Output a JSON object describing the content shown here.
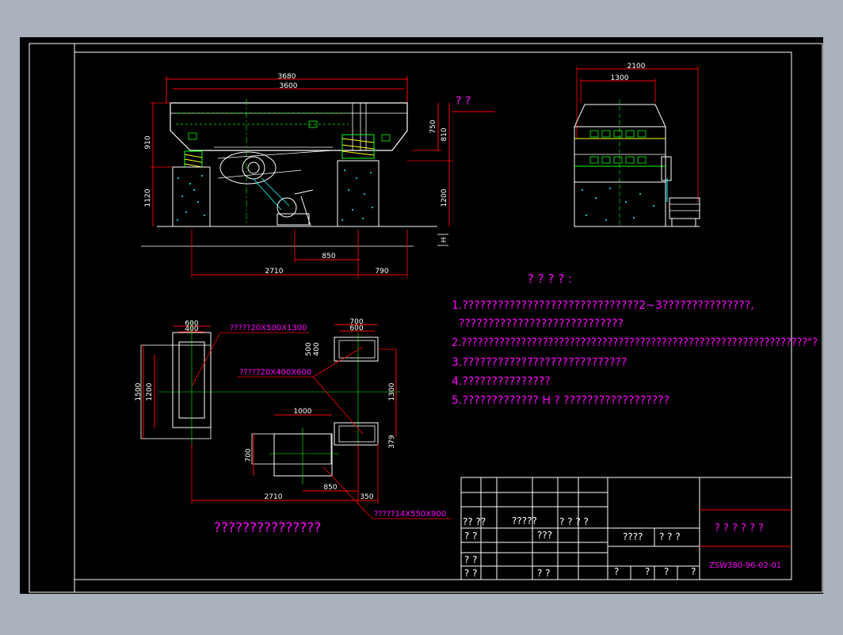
{
  "front_view": {
    "dims": {
      "total_length": "3680",
      "inner_length": "3600",
      "height_top": "910",
      "height_bottom": "1120",
      "right_a": "750",
      "right_b": "810",
      "right_c": "1200",
      "mid": "850",
      "base": "2710",
      "right_base": "790",
      "h_marker": "H"
    },
    "section_mark": "?  ?"
  },
  "side_view": {
    "dims": {
      "width": "2100",
      "inner": "1300"
    }
  },
  "plan_view": {
    "dims": {
      "left_w": "600",
      "left_inner": "400",
      "left_h": "1500",
      "left_inner_h": "1200",
      "top_w": "700",
      "top_inner": "600",
      "top_h": "500",
      "top_inner_h": "400",
      "motor_w": "1000",
      "motor_h": "700",
      "motor_off": "850",
      "small": "350",
      "span": "1300",
      "right_small": "379",
      "base": "2710"
    },
    "callouts": {
      "anchor_large": "?????20X500X1300",
      "anchor_small": "?????20X400X600",
      "anchor_motor": "?????14X550X900"
    },
    "caption": "???????????????"
  },
  "notes": {
    "heading": "?  ?  ?  ?  :",
    "lines": [
      "1.??????????????????????????????2~3???????????????,",
      "  ????????????????????????????",
      "2.????????????????????????????????????????????????????????????????\"?",
      "3.????????????????????????????",
      "4.???????????????",
      "5.?????????????  H  ?  ??????????????????"
    ]
  },
  "title_block": {
    "cells": [
      "?? ??",
      "?????",
      "? ? ? ?",
      "? ?",
      "???",
      "????",
      "? ? ?",
      "? ?",
      "? ?",
      "? ?",
      "?",
      "?",
      "?",
      "?"
    ],
    "drawing_title": "? ? ? ? ? ?",
    "drawing_number": "ZSW380-96-02-01"
  },
  "colors": {
    "frame": "#ffffff",
    "dimension": "#ff0000",
    "centerline": "#00ff00",
    "note_text": "#ff00ff",
    "concrete": "#00ffff",
    "background": "#000000"
  }
}
